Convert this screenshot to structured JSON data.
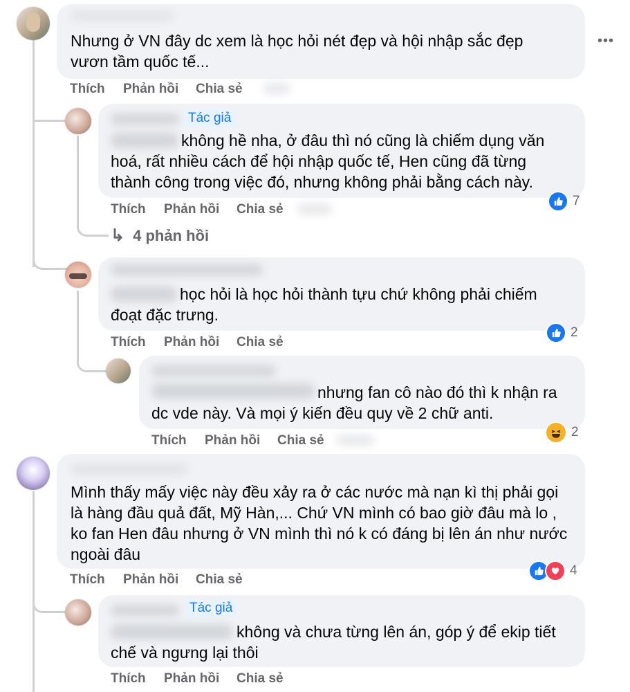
{
  "actions": {
    "like": "Thích",
    "reply": "Phản hồi",
    "share": "Chia sẻ"
  },
  "author_badge": "Tác giả",
  "comments": [
    {
      "lines": [
        "Nhưng ở VN đây dc xem là học hỏi nét đẹp và hội nhập sắc đẹp",
        "vươn tầm quốc tế..."
      ],
      "reaction_count": null
    },
    {
      "lines": [
        "không hề nha, ở đâu thì nó cũng là chiếm dụng văn",
        "hoá, rất nhiều cách để hội nhập quốc tế, Hen cũng đã từng",
        "thành công trong việc đó, nhưng không phải bằng cách này."
      ],
      "reaction_count": "7",
      "reaction": "like-icon"
    },
    {
      "lines": [
        "học hỏi là học hỏi thành tựu chứ không phải chiếm",
        "đoạt đặc trưng."
      ],
      "reaction_count": "2",
      "reaction": "like-icon"
    },
    {
      "lines": [
        "nhưng fan cô nào đó thì k nhận ra",
        "dc vde này. Và mọi ý kiến đều quy về 2 chữ anti."
      ],
      "reaction_count": "2",
      "reaction": "haha-icon"
    },
    {
      "lines": [
        "Mình thấy mấy việc này đều xảy ra ở các nước mà nạn kì thị phải gọi",
        "là hàng đầu quả đất, Mỹ Hàn,... Chứ VN mình có bao giờ đâu mà lo ,",
        "ko fan Hen đâu nhưng ở VN mình thì nó k có đáng bị lên án như nước",
        "ngoài đâu"
      ],
      "reaction_count": "4",
      "reaction": "like-love-icons"
    },
    {
      "lines": [
        "không và chưa từng lên án, góp ý để ekip tiết",
        "chế và ngưng lại thôi"
      ],
      "reaction_count": null
    }
  ],
  "view_replies": "4 phản hồi",
  "more_options": "•••",
  "colors": {
    "bubble": "#f0f2f5",
    "secondary_text": "#65676b",
    "like_blue": "#1877f2",
    "love_red": "#f33e58",
    "haha_yellow": "#f7b125",
    "thread_line": "#ced0d4"
  }
}
